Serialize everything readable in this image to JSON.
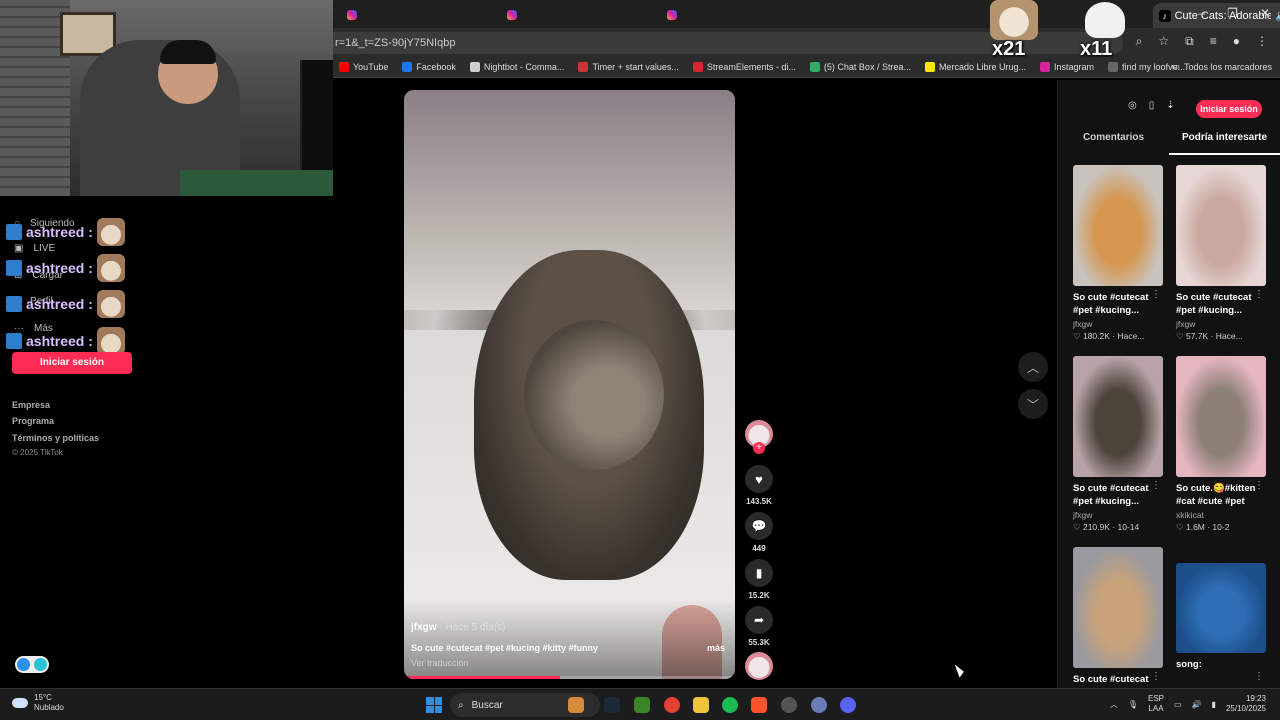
{
  "browser": {
    "active_tab_title": "Cute Cats: Adorable Kitty M",
    "url": "r=1&_t=ZS-90jY75NIqbp",
    "bookmarks": [
      {
        "label": "YouTube",
        "color": "#ff0000"
      },
      {
        "label": "Facebook",
        "color": "#1877f2"
      },
      {
        "label": "Nightbot - Comma...",
        "color": "#cfcfcf"
      },
      {
        "label": "Timer + start values...",
        "color": "#c33"
      },
      {
        "label": "StreamElements - di...",
        "color": "#d23"
      },
      {
        "label": "(5) Chat Box / Strea...",
        "color": "#3a6"
      },
      {
        "label": "Mercado Libre Urug...",
        "color": "#ffe600"
      },
      {
        "label": "Instagram",
        "color": "#d6249f"
      },
      {
        "label": "find my loofve...",
        "color": "#666"
      }
    ],
    "all_bookmarks": "Todos los marcadores"
  },
  "overlay": {
    "counter_left": "x21",
    "counter_right": "x11",
    "chat_user": "ashtreed :"
  },
  "leftnav": {
    "items": [
      "Siguiendo",
      "LIVE",
      "Cargar",
      "Perfil",
      "Más"
    ],
    "login_label": "Iniciar sesión",
    "footer": [
      "Empresa",
      "Programa",
      "Términos y políticas"
    ],
    "copyright": "© 2025 TikTok"
  },
  "video": {
    "author": "jfxgw",
    "time": " · Hace 5 día(s)",
    "caption": "So cute #cutecat #pet #kucing #kitty #funny",
    "more": "más",
    "translate": "Ver traducción",
    "progress": 0.47
  },
  "actions": {
    "likes": "143.5K",
    "comments": "449",
    "saves": "15.2K",
    "shares": "55.3K"
  },
  "rightpanel": {
    "login_label": "Iniciar sesión",
    "tabs": [
      "Comentarios",
      "Podría interesarte"
    ],
    "cards": [
      {
        "title": "So cute #cutecat",
        "title2": "#pet #kucing...",
        "author": "jfxgw",
        "meta": "♡ 180.2K · Hace...",
        "colors": [
          "#c9c3bd",
          "#d5964f"
        ]
      },
      {
        "title": "So cute #cutecat",
        "title2": "#pet #kucing...",
        "author": "jfxgw",
        "meta": "♡ 57.7K · Hace...",
        "colors": [
          "#e6d6d5",
          "#c9a99e"
        ]
      },
      {
        "title": "So cute #cutecat",
        "title2": "#pet #kucing...",
        "author": "jfxgw",
        "meta": "♡ 210.9K · 10-14",
        "colors": [
          "#b8a4a8",
          "#4c433b"
        ]
      },
      {
        "title": "So cute.😋#kitten",
        "title2": "#cat #cute #pet",
        "author": "xkikicat",
        "meta": "♡ 1.6M · 10-2",
        "colors": [
          "#e5b5c0",
          "#8d8078"
        ]
      },
      {
        "title": "So cute #cutecat",
        "title2": "",
        "author": "",
        "meta": "",
        "colors": [
          "#9a9aa0",
          "#c7a27a"
        ]
      },
      {
        "title": "song:",
        "title2": "",
        "author": "",
        "meta": "",
        "colors": [
          "#1c4f8a",
          "#2e6db5"
        ]
      }
    ]
  },
  "taskbar": {
    "temp": "15°C",
    "weather": "Nublado",
    "search": "Buscar",
    "lang1": "ESP",
    "lang2": "LAA",
    "time": "19:23",
    "date": "25/10/2025"
  }
}
